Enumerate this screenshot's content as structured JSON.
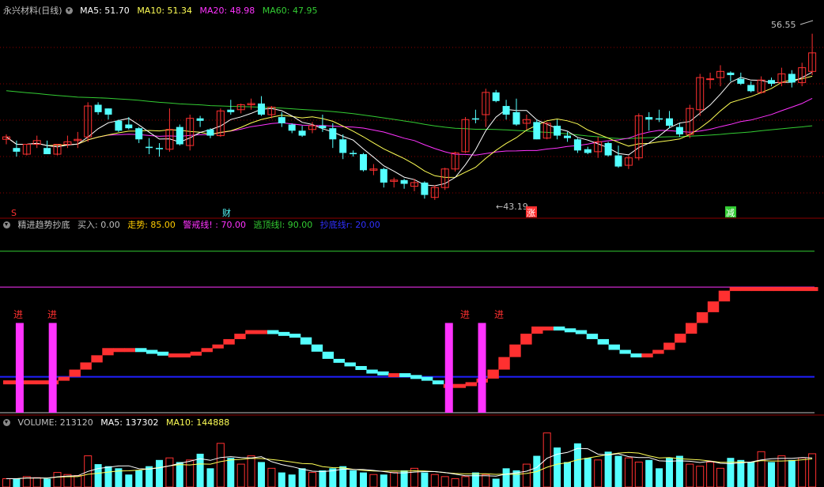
{
  "colors": {
    "bg": "#000000",
    "up": "#ff3030",
    "down": "#54ffff",
    "ma5": "#ffffff",
    "ma10": "#ffff55",
    "ma20": "#ff33ff",
    "ma60": "#33cc33",
    "grid": "#8b0000",
    "blue": "#2020ff",
    "green": "#33cc33",
    "magenta": "#ff33ff",
    "yellow": "#ffcc00"
  },
  "main_header": {
    "stock": "永兴材料",
    "period": "(日线)",
    "ma5": "MA5: 51.70",
    "ma10": "MA10: 51.34",
    "ma20": "MA20: 48.98",
    "ma60": "MA60: 47.95"
  },
  "main_annotations": {
    "high_label": "56.55",
    "low_label": "←43.19",
    "marker_s": "S",
    "marker_cai": "财",
    "marker_zhang": "涨",
    "marker_jian": "减"
  },
  "indicator_header": {
    "name": "精进趋势抄底",
    "buy": "买入: 0.00",
    "trend": "走势: 85.00",
    "warn": "警戒线! : 70.00",
    "escape": "逃顶线l: 90.00",
    "bottom": "抄底线r: 20.00"
  },
  "indicator_labels": [
    "进",
    "进",
    "进",
    "进"
  ],
  "volume_header": {
    "vol": "VOLUME: 213120",
    "ma5": "MA5: 137302",
    "ma10": "MA10: 144888"
  },
  "chart_data": [
    {
      "type": "candlestick",
      "title": "永兴材料 (日线)",
      "ylim": [
        42,
        58
      ],
      "candles": [
        [
          48.0,
          48.4,
          47.6,
          48.2
        ],
        [
          47.3,
          47.9,
          46.6,
          47.0
        ],
        [
          46.8,
          47.6,
          46.7,
          47.6
        ],
        [
          47.6,
          48.3,
          47.3,
          47.9
        ],
        [
          47.3,
          47.9,
          47.0,
          46.8
        ],
        [
          46.8,
          47.6,
          46.7,
          47.6
        ],
        [
          47.6,
          48.3,
          47.3,
          47.8
        ],
        [
          47.9,
          48.6,
          47.3,
          48.0
        ],
        [
          48.2,
          51.0,
          47.8,
          50.7
        ],
        [
          50.8,
          51.0,
          50.0,
          50.2
        ],
        [
          50.5,
          50.5,
          49.6,
          50.0
        ],
        [
          49.5,
          49.6,
          48.6,
          48.7
        ],
        [
          49.2,
          49.8,
          48.8,
          48.9
        ],
        [
          48.9,
          49.0,
          47.7,
          48.0
        ],
        [
          47.4,
          48.1,
          46.8,
          47.3
        ],
        [
          47.3,
          47.7,
          46.6,
          47.2
        ],
        [
          47.2,
          50.5,
          47.0,
          48.8
        ],
        [
          49.0,
          49.2,
          47.5,
          47.6
        ],
        [
          47.5,
          50.0,
          47.1,
          49.7
        ],
        [
          49.7,
          49.9,
          49.0,
          49.5
        ],
        [
          48.8,
          48.9,
          48.1,
          48.3
        ],
        [
          48.3,
          50.5,
          48.2,
          50.3
        ],
        [
          50.4,
          51.2,
          50.0,
          50.2
        ],
        [
          50.4,
          50.9,
          50.1,
          50.8
        ],
        [
          50.8,
          51.3,
          50.4,
          50.9
        ],
        [
          50.9,
          51.5,
          49.9,
          50.0
        ],
        [
          50.0,
          50.7,
          49.7,
          50.6
        ],
        [
          49.8,
          50.2,
          49.0,
          49.3
        ],
        [
          49.2,
          49.3,
          48.5,
          48.7
        ],
        [
          48.7,
          49.1,
          48.2,
          48.3
        ],
        [
          48.8,
          49.4,
          48.5,
          49.1
        ],
        [
          49.1,
          50.0,
          48.6,
          48.9
        ],
        [
          48.9,
          49.3,
          47.3,
          48.0
        ],
        [
          48.0,
          48.4,
          46.4,
          46.9
        ],
        [
          46.9,
          47.1,
          46.6,
          46.8
        ],
        [
          46.8,
          46.9,
          45.4,
          45.5
        ],
        [
          45.5,
          46.0,
          45.1,
          45.6
        ],
        [
          45.6,
          45.7,
          44.1,
          44.5
        ],
        [
          44.6,
          44.9,
          44.1,
          44.7
        ],
        [
          44.7,
          44.8,
          44.0,
          44.4
        ],
        [
          44.2,
          44.8,
          43.8,
          44.5
        ],
        [
          44.5,
          44.6,
          43.2,
          43.5
        ],
        [
          43.3,
          44.3,
          43.1,
          44.1
        ],
        [
          44.1,
          45.7,
          43.9,
          45.6
        ],
        [
          45.6,
          47.0,
          45.4,
          46.9
        ],
        [
          47.0,
          49.8,
          46.9,
          49.6
        ],
        [
          49.7,
          50.4,
          49.3,
          49.6
        ],
        [
          50.0,
          52.1,
          49.0,
          51.8
        ],
        [
          51.8,
          52.0,
          51.0,
          51.1
        ],
        [
          50.7,
          51.2,
          49.6,
          50.0
        ],
        [
          50.2,
          51.3,
          49.1,
          49.2
        ],
        [
          49.3,
          50.0,
          48.8,
          49.6
        ],
        [
          49.4,
          49.6,
          48.0,
          48.0
        ],
        [
          48.1,
          49.4,
          48.0,
          49.3
        ],
        [
          49.1,
          49.6,
          48.0,
          48.3
        ],
        [
          48.3,
          48.6,
          47.8,
          48.1
        ],
        [
          48.0,
          48.1,
          46.9,
          47.1
        ],
        [
          47.2,
          47.4,
          46.8,
          46.9
        ],
        [
          47.0,
          48.2,
          46.5,
          47.8
        ],
        [
          47.7,
          47.8,
          46.6,
          46.7
        ],
        [
          46.7,
          47.5,
          45.7,
          45.8
        ],
        [
          45.9,
          46.7,
          45.6,
          46.5
        ],
        [
          46.5,
          50.1,
          46.3,
          49.9
        ],
        [
          49.8,
          50.2,
          48.7,
          49.6
        ],
        [
          49.7,
          50.4,
          49.4,
          49.6
        ],
        [
          49.7,
          50.3,
          48.9,
          49.1
        ],
        [
          49.0,
          49.3,
          48.2,
          48.4
        ],
        [
          48.4,
          50.8,
          48.1,
          50.5
        ],
        [
          50.4,
          53.3,
          49.9,
          53.0
        ],
        [
          52.9,
          53.4,
          52.1,
          52.9
        ],
        [
          53.0,
          54.0,
          52.3,
          53.5
        ],
        [
          53.4,
          53.5,
          52.7,
          53.2
        ],
        [
          52.9,
          53.4,
          52.4,
          52.5
        ],
        [
          52.4,
          52.7,
          51.8,
          51.9
        ],
        [
          51.8,
          53.1,
          51.7,
          52.8
        ],
        [
          52.8,
          53.0,
          52.3,
          52.5
        ],
        [
          52.6,
          53.8,
          52.3,
          53.3
        ],
        [
          53.3,
          53.6,
          52.2,
          52.6
        ],
        [
          52.6,
          54.2,
          52.3,
          53.8
        ],
        [
          53.5,
          56.55,
          53.2,
          55.0
        ]
      ]
    },
    {
      "type": "bar",
      "title": "精进趋势抄底",
      "ylim": [
        0,
        100
      ],
      "reference_lines": {
        "escape": 90.0,
        "warn": 70.0,
        "bottom": 20.0
      },
      "buy_signals": [
        1,
        4,
        40,
        43
      ],
      "values": [
        18,
        18,
        18,
        18,
        18,
        20,
        24,
        28,
        32,
        36,
        36,
        36,
        35,
        34,
        33,
        33,
        33,
        34,
        36,
        38,
        41,
        44,
        46,
        46,
        45,
        44,
        42,
        38,
        34,
        30,
        28,
        26,
        24,
        23,
        22,
        22,
        21,
        20,
        18,
        16,
        16,
        16,
        17,
        19,
        24,
        31,
        38,
        44,
        48,
        48,
        47,
        46,
        44,
        41,
        38,
        35,
        33,
        32,
        33,
        35,
        39,
        44,
        50,
        56,
        62,
        68,
        70,
        70,
        70,
        70,
        70,
        70,
        70,
        70
      ]
    },
    {
      "type": "bar",
      "title": "VOLUME",
      "values": [
        40,
        40,
        50,
        45,
        40,
        70,
        60,
        55,
        150,
        110,
        100,
        90,
        60,
        80,
        100,
        130,
        140,
        120,
        130,
        160,
        90,
        210,
        140,
        110,
        150,
        120,
        90,
        70,
        60,
        90,
        70,
        80,
        90,
        100,
        80,
        70,
        60,
        60,
        70,
        80,
        90,
        70,
        60,
        50,
        40,
        50,
        70,
        60,
        40,
        90,
        80,
        110,
        150,
        260,
        190,
        120,
        210,
        140,
        130,
        170,
        150,
        140,
        120,
        130,
        90,
        140,
        150,
        110,
        100,
        120,
        90,
        140,
        130,
        120,
        170,
        120,
        150,
        130,
        140,
        160
      ]
    }
  ]
}
